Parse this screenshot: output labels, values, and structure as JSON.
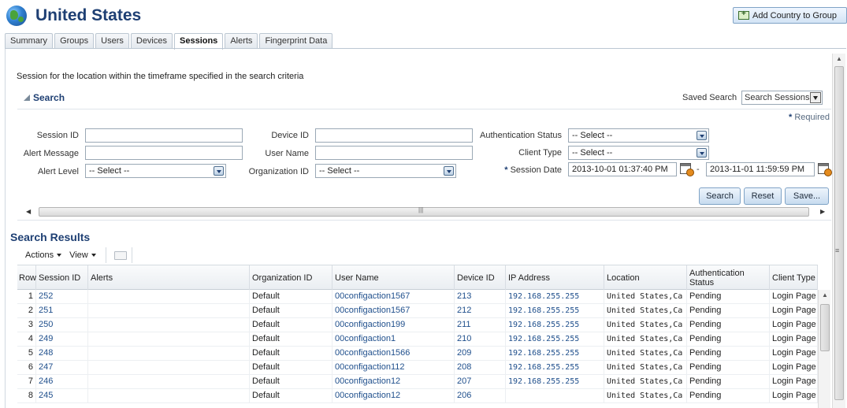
{
  "header": {
    "title": "United States",
    "add_button_label": "Add Country to Group"
  },
  "tabs": [
    {
      "label": "Summary",
      "active": false
    },
    {
      "label": "Groups",
      "active": false
    },
    {
      "label": "Users",
      "active": false
    },
    {
      "label": "Devices",
      "active": false
    },
    {
      "label": "Sessions",
      "active": true
    },
    {
      "label": "Alerts",
      "active": false
    },
    {
      "label": "Fingerprint Data",
      "active": false
    }
  ],
  "description": "Session for the location within the timeframe specified in the search criteria",
  "search": {
    "title": "Search",
    "saved_search_label": "Saved Search",
    "saved_search_value": "Search Sessions",
    "required_note": "Required",
    "fields": {
      "session_id_label": "Session ID",
      "session_id_value": "",
      "alert_message_label": "Alert Message",
      "alert_message_value": "",
      "alert_level_label": "Alert Level",
      "alert_level_value": "-- Select --",
      "device_id_label": "Device ID",
      "device_id_value": "",
      "user_name_label": "User Name",
      "user_name_value": "",
      "organization_id_label": "Organization ID",
      "organization_id_value": "-- Select --",
      "auth_status_label": "Authentication Status",
      "auth_status_value": "-- Select --",
      "client_type_label": "Client Type",
      "client_type_value": "-- Select --",
      "session_date_label": "Session Date",
      "session_date_from": "2013-10-01 01:37:40 PM",
      "session_date_to": "2013-11-01 11:59:59 PM"
    },
    "buttons": {
      "search": "Search",
      "reset": "Reset",
      "save": "Save..."
    }
  },
  "results": {
    "title": "Search Results",
    "actions_label": "Actions",
    "view_label": "View",
    "columns": [
      "Row",
      "Session ID",
      "Alerts",
      "Organization ID",
      "User Name",
      "Device ID",
      "IP Address",
      "Location",
      "Authentication Status",
      "Client Type"
    ],
    "rows": [
      {
        "row": "1",
        "session_id": "252",
        "alerts": "",
        "org": "Default",
        "user": "00configaction1567",
        "device": "213",
        "ip": "192.168.255.255",
        "location": "United States,Ca",
        "auth": "Pending",
        "client": "Login Page"
      },
      {
        "row": "2",
        "session_id": "251",
        "alerts": "",
        "org": "Default",
        "user": "00configaction1567",
        "device": "212",
        "ip": "192.168.255.255",
        "location": "United States,Ca",
        "auth": "Pending",
        "client": "Login Page"
      },
      {
        "row": "3",
        "session_id": "250",
        "alerts": "",
        "org": "Default",
        "user": "00configaction199",
        "device": "211",
        "ip": "192.168.255.255",
        "location": "United States,Ca",
        "auth": "Pending",
        "client": "Login Page"
      },
      {
        "row": "4",
        "session_id": "249",
        "alerts": "",
        "org": "Default",
        "user": "00configaction1",
        "device": "210",
        "ip": "192.168.255.255",
        "location": "United States,Ca",
        "auth": "Pending",
        "client": "Login Page"
      },
      {
        "row": "5",
        "session_id": "248",
        "alerts": "",
        "org": "Default",
        "user": "00configaction1566",
        "device": "209",
        "ip": "192.168.255.255",
        "location": "United States,Ca",
        "auth": "Pending",
        "client": "Login Page"
      },
      {
        "row": "6",
        "session_id": "247",
        "alerts": "",
        "org": "Default",
        "user": "00configaction112",
        "device": "208",
        "ip": "192.168.255.255",
        "location": "United States,Ca",
        "auth": "Pending",
        "client": "Login Page"
      },
      {
        "row": "7",
        "session_id": "246",
        "alerts": "",
        "org": "Default",
        "user": "00configaction12",
        "device": "207",
        "ip": "192.168.255.255",
        "location": "United States,Ca",
        "auth": "Pending",
        "client": "Login Page"
      },
      {
        "row": "8",
        "session_id": "245",
        "alerts": "",
        "org": "Default",
        "user": "00configaction12",
        "device": "206",
        "ip": "",
        "location": "United States,Ca",
        "auth": "Pending",
        "client": "Login Page"
      }
    ]
  },
  "colors": {
    "title": "#1e3f73",
    "link": "#1f4f8c",
    "button_top": "#eef5fc",
    "button_bottom": "#c7dbef"
  }
}
